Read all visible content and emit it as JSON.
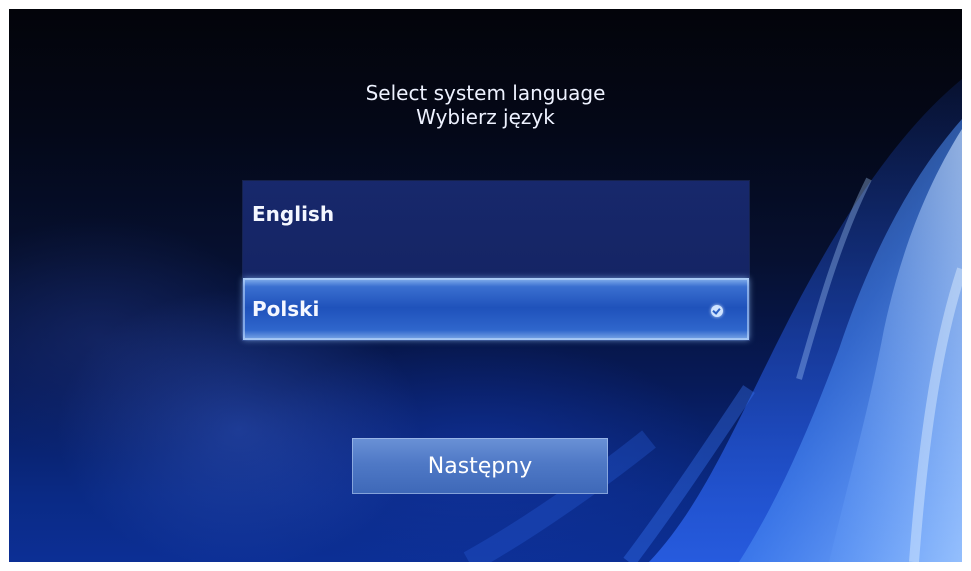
{
  "header": {
    "title_line1": "Select system language",
    "title_line2": "Wybierz język"
  },
  "languages": {
    "items": [
      {
        "label": "English",
        "selected": false
      },
      {
        "label": "Polski",
        "selected": true
      }
    ],
    "selected_indicator_icon": "check-circle-icon"
  },
  "actions": {
    "next_label": "Następny"
  },
  "colors": {
    "background_dark": "#03040a",
    "background_blue": "#0c2f95",
    "list_panel": "#1a2c76",
    "selected_item": "#1f52bb",
    "button": "#4f79c6",
    "text": "#f4f7ff"
  }
}
